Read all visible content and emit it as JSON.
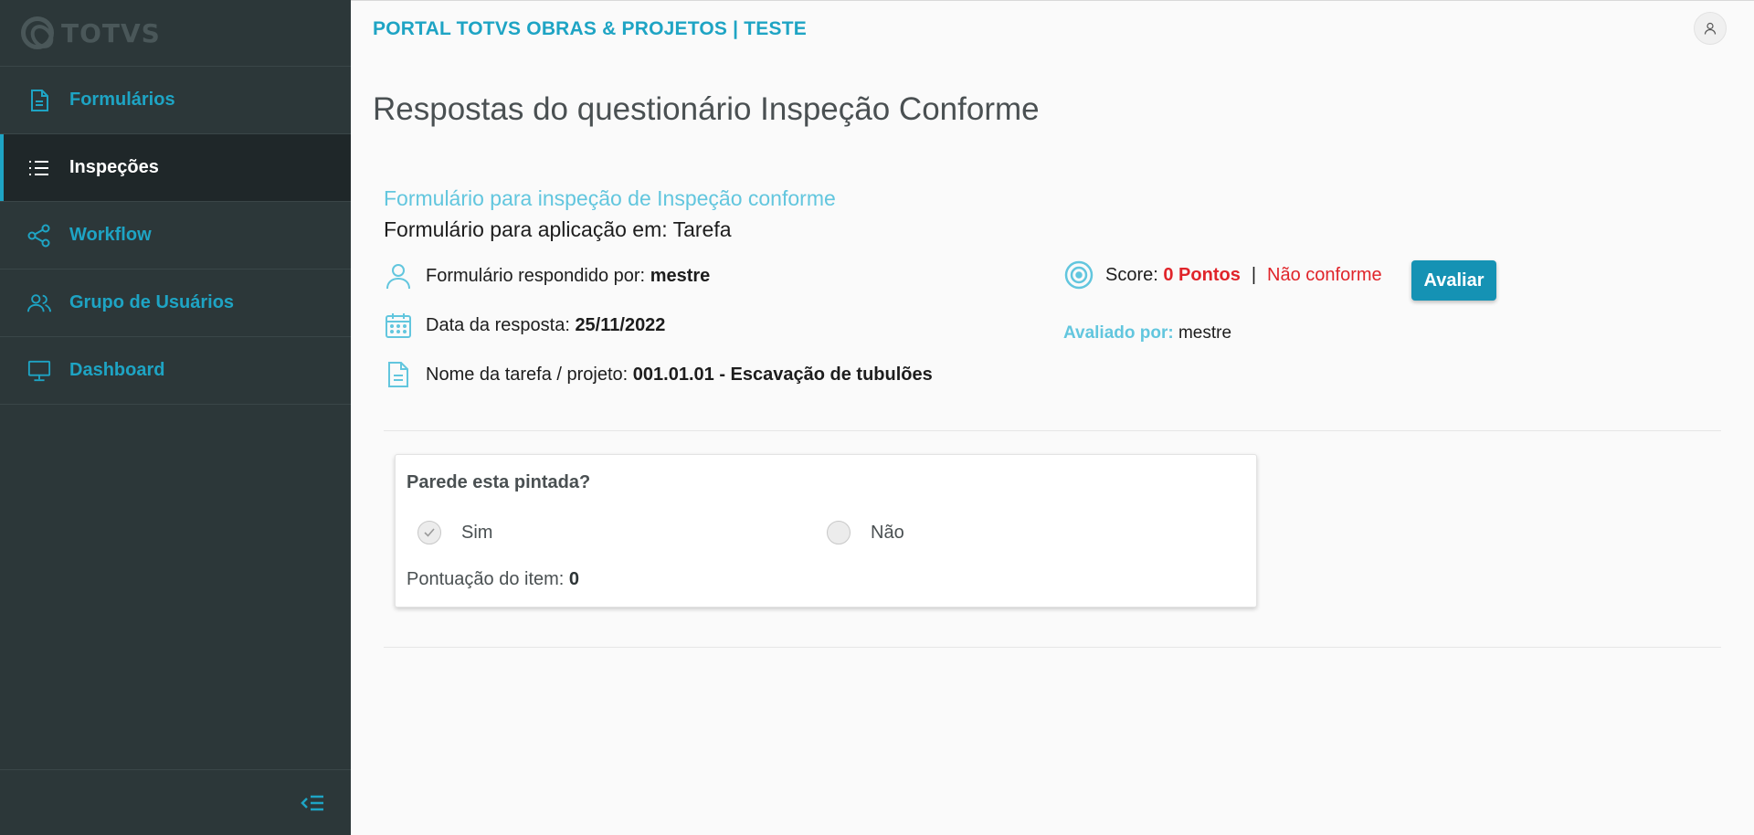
{
  "sidebar": {
    "logo_text": "TOTVS",
    "items": [
      {
        "label": "Formulários",
        "icon": "document-icon"
      },
      {
        "label": "Inspeções",
        "icon": "list-icon"
      },
      {
        "label": "Workflow",
        "icon": "share-icon"
      },
      {
        "label": "Grupo de Usuários",
        "icon": "users-icon"
      },
      {
        "label": "Dashboard",
        "icon": "monitor-icon"
      }
    ],
    "active_item": "Inspeções",
    "collapse_icon": "collapse-menu-icon"
  },
  "header": {
    "portal_title": "PORTAL TOTVS OBRAS & PROJETOS | TESTE",
    "user_icon": "user-icon"
  },
  "page": {
    "title": "Respostas do questionário Inspeção Conforme",
    "form_subtitle": "Formulário para inspeção de Inspeção conforme",
    "form_applied": "Formulário para aplicação em: Tarefa"
  },
  "info": {
    "responded_by_label": "Formulário respondido por:",
    "responded_by_value": "mestre",
    "date_label": "Data da resposta:",
    "date_value": "25/11/2022",
    "task_label": "Nome da tarefa / projeto:",
    "task_value": "001.01.01 - Escavação de tubulões"
  },
  "score": {
    "label": "Score:",
    "points": "0 Pontos",
    "separator": "|",
    "status": "Não conforme",
    "evaluate_button": "Avaliar",
    "evaluated_by_label": "Avaliado por:",
    "evaluated_by_value": "mestre"
  },
  "question": {
    "title": "Parede esta pintada?",
    "options": [
      "Sim",
      "Não"
    ],
    "selected": "Sim",
    "item_score_label": "Pontuação do item:",
    "item_score_value": "0"
  },
  "colors": {
    "accent": "#1ea4c4",
    "sidebar_bg": "#2c3739",
    "button_bg": "#1592b4",
    "alert_red": "#e0242a",
    "subtitle": "#62c6de"
  }
}
